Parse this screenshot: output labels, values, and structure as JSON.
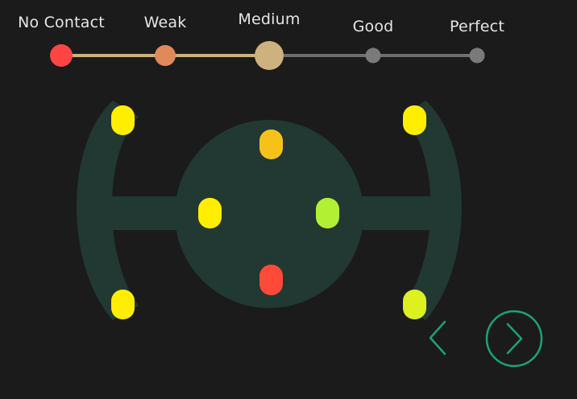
{
  "contact_scale": {
    "levels": [
      {
        "label": "No Contact",
        "color": "#ff4444"
      },
      {
        "label": "Weak",
        "color": "#e08a5c"
      },
      {
        "label": "Medium",
        "color": "#cdb17e"
      },
      {
        "label": "Good",
        "color": "#7a7a7a"
      },
      {
        "label": "Perfect",
        "color": "#7a7a7a"
      }
    ],
    "current_level": "Medium",
    "active_track_color": "#cdb17e",
    "inactive_track_color": "#6e6e6e"
  },
  "headset": {
    "band_color": "#223832",
    "sensors": [
      {
        "id": "left-top",
        "status": "Perfect",
        "color": "#ffee00"
      },
      {
        "id": "left-bottom",
        "status": "Perfect",
        "color": "#ffee00"
      },
      {
        "id": "right-top",
        "status": "Perfect",
        "color": "#ffee00"
      },
      {
        "id": "right-bottom",
        "status": "Good",
        "color": "#ddf020"
      },
      {
        "id": "center-top",
        "status": "Good",
        "color": "#f6c21a"
      },
      {
        "id": "center-left",
        "status": "Perfect",
        "color": "#ffee00"
      },
      {
        "id": "center-right",
        "status": "Good",
        "color": "#b2f034"
      },
      {
        "id": "center-bottom",
        "status": "No Contact",
        "color": "#ff4a3a"
      }
    ]
  },
  "navigation": {
    "prev_icon": "chevron-left-icon",
    "next_icon": "chevron-right-circle-icon",
    "accent_color": "#1aa37a"
  }
}
